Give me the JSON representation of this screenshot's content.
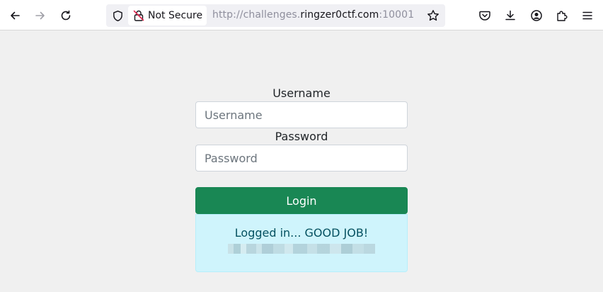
{
  "browser": {
    "security_label": "Not Secure",
    "url_prefix": "http://challenges.",
    "url_host": "ringzer0ctf.com",
    "url_suffix": ":10001"
  },
  "form": {
    "username_label": "Username",
    "username_placeholder": "Username",
    "password_label": "Password",
    "password_placeholder": "Password",
    "login_label": "Login"
  },
  "alert": {
    "message": "Logged in... GOOD JOB!"
  },
  "colors": {
    "login_button": "#198754",
    "alert_background": "#cff4fc",
    "alert_text": "#055160"
  }
}
